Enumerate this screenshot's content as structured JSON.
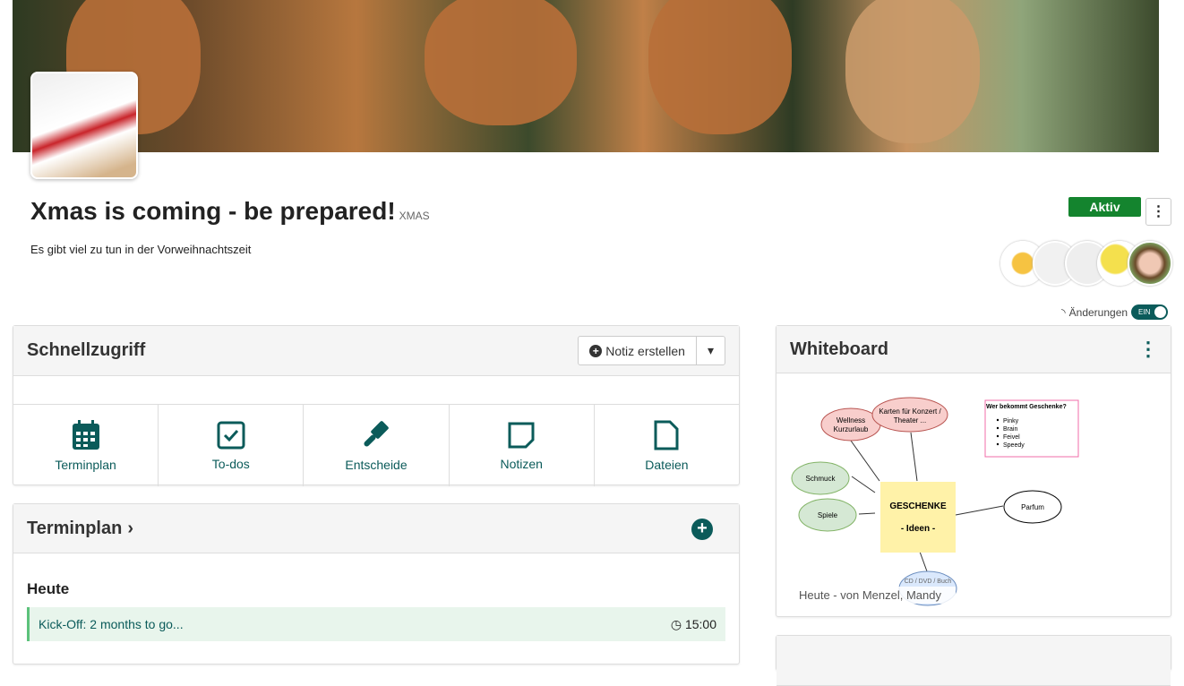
{
  "header": {
    "title": "Xmas is coming - be prepared!",
    "shortname": "XMAS",
    "description": "Es gibt viel zu tun in der Vorweihnachtszeit",
    "status": "Aktiv",
    "changes_label": "Änderungen",
    "toggle_label": "EIN"
  },
  "quick": {
    "title": "Schnellzugriff",
    "create_note": "Notiz erstellen",
    "tiles": [
      {
        "label": "Terminplan",
        "icon": "calendar-icon"
      },
      {
        "label": "To-dos",
        "icon": "checkbox-icon"
      },
      {
        "label": "Entscheide",
        "icon": "gavel-icon"
      },
      {
        "label": "Notizen",
        "icon": "note-icon"
      },
      {
        "label": "Dateien",
        "icon": "file-icon"
      }
    ]
  },
  "schedule": {
    "title": "Terminplan",
    "day": "Heute",
    "events": [
      {
        "title": "Kick-Off: 2 months to go...",
        "time": "15:00"
      }
    ]
  },
  "whiteboard": {
    "title": "Whiteboard",
    "caption": "Heute - von Menzel, Mandy",
    "center": [
      "GESCHENKE",
      "- Ideen -"
    ],
    "nodes": [
      "Wellness Kurzurlaub",
      "Karten für Konzert / Theater ...",
      "Schmuck",
      "Spiele",
      "Parfum",
      "CD / DVD / Buch"
    ],
    "list_title": "Wer bekommt Geschenke?",
    "list": [
      "Pinky",
      "Brain",
      "Feivel",
      "Speedy"
    ]
  },
  "colors": {
    "accent": "#0b5b5a",
    "active": "#14842e"
  }
}
